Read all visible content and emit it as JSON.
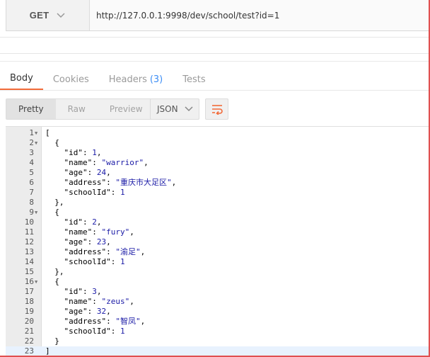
{
  "request": {
    "method": "GET",
    "url": "http://127.0.0.1:9998/dev/school/test?id=1"
  },
  "response_tabs": [
    {
      "label": "Body",
      "badge": "",
      "active": true
    },
    {
      "label": "Cookies",
      "badge": "",
      "active": false
    },
    {
      "label": "Headers",
      "badge": "(3)",
      "active": false
    },
    {
      "label": "Tests",
      "badge": "",
      "active": false
    }
  ],
  "format": {
    "modes": [
      "Pretty",
      "Raw",
      "Preview"
    ],
    "active_mode": "Pretty",
    "language": "JSON"
  },
  "code_lines": [
    {
      "n": "1",
      "fold": true,
      "text": "["
    },
    {
      "n": "2",
      "fold": true,
      "text": "  {"
    },
    {
      "n": "3",
      "fold": false,
      "text": "    \"id\": 1,"
    },
    {
      "n": "4",
      "fold": false,
      "text": "    \"name\": \"warrior\","
    },
    {
      "n": "5",
      "fold": false,
      "text": "    \"age\": 24,"
    },
    {
      "n": "6",
      "fold": false,
      "text": "    \"address\": \"重庆市大足区\","
    },
    {
      "n": "7",
      "fold": false,
      "text": "    \"schoolId\": 1"
    },
    {
      "n": "8",
      "fold": false,
      "text": "  },"
    },
    {
      "n": "9",
      "fold": true,
      "text": "  {"
    },
    {
      "n": "10",
      "fold": false,
      "text": "    \"id\": 2,"
    },
    {
      "n": "11",
      "fold": false,
      "text": "    \"name\": \"fury\","
    },
    {
      "n": "12",
      "fold": false,
      "text": "    \"age\": 23,"
    },
    {
      "n": "13",
      "fold": false,
      "text": "    \"address\": \"渝足\","
    },
    {
      "n": "14",
      "fold": false,
      "text": "    \"schoolId\": 1"
    },
    {
      "n": "15",
      "fold": false,
      "text": "  },"
    },
    {
      "n": "16",
      "fold": true,
      "text": "  {"
    },
    {
      "n": "17",
      "fold": false,
      "text": "    \"id\": 3,"
    },
    {
      "n": "18",
      "fold": false,
      "text": "    \"name\": \"zeus\","
    },
    {
      "n": "19",
      "fold": false,
      "text": "    \"age\": 32,"
    },
    {
      "n": "20",
      "fold": false,
      "text": "    \"address\": \"智凤\","
    },
    {
      "n": "21",
      "fold": false,
      "text": "    \"schoolId\": 1"
    },
    {
      "n": "22",
      "fold": false,
      "text": "  }"
    },
    {
      "n": "23",
      "fold": false,
      "text": "]"
    }
  ],
  "colors": {
    "accent": "#f26b3a",
    "badge": "#3d8ef5",
    "string": "#1a1aa6"
  },
  "icons": {
    "method_dropdown": "chevron-down-icon",
    "language_dropdown": "chevron-down-icon",
    "wrap": "wrap-lines-icon"
  }
}
